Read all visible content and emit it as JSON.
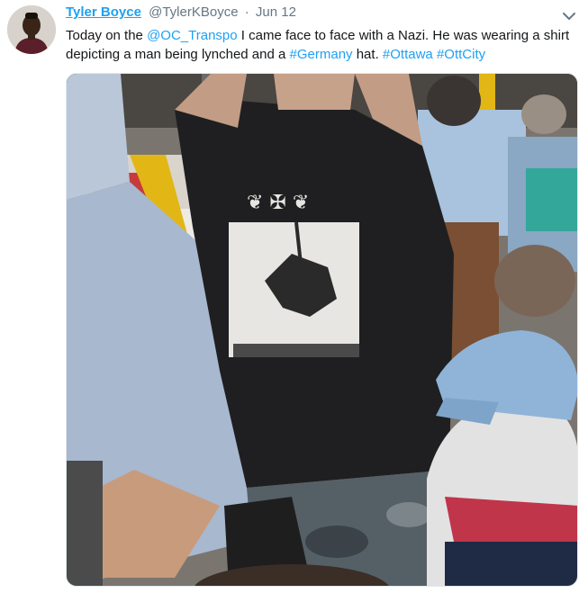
{
  "tweet": {
    "display_name": "Tyler Boyce",
    "handle": "@TylerKBoyce",
    "separator": "·",
    "date": "Jun 12",
    "text_parts": [
      {
        "type": "text",
        "value": "Today on the "
      },
      {
        "type": "mention",
        "value": "@OC_Transpo"
      },
      {
        "type": "text",
        "value": " I came face to face with a Nazi. He was wearing a shirt depicting a man being lynched and a "
      },
      {
        "type": "hashtag",
        "value": "#Germany"
      },
      {
        "type": "text",
        "value": " hat. "
      },
      {
        "type": "hashtag",
        "value": "#Ottawa"
      },
      {
        "type": "text",
        "value": " "
      },
      {
        "type": "hashtag",
        "value": "#OttCity"
      }
    ]
  },
  "icons": {
    "menu": "chevron-down-icon"
  },
  "colors": {
    "link": "#1da1f2",
    "secondary_text": "#657786",
    "primary_text": "#14171a"
  }
}
